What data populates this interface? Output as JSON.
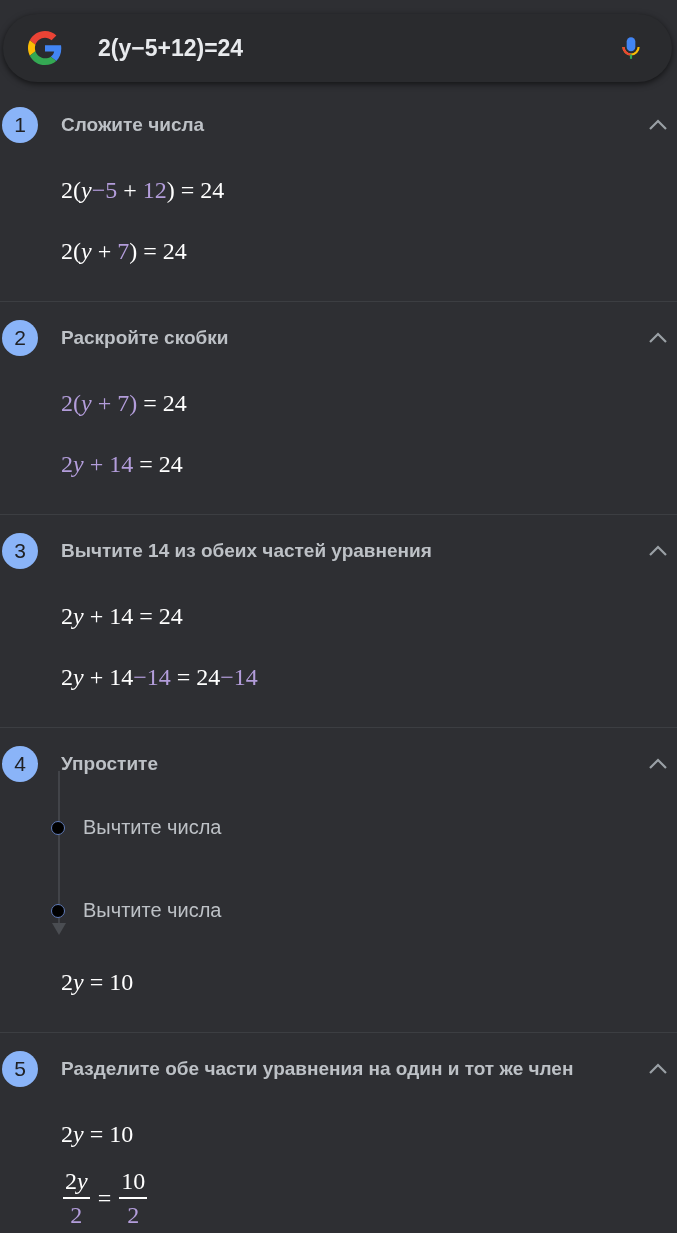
{
  "search": {
    "query": "2(y−5+12)=24"
  },
  "steps": [
    {
      "number": "1",
      "title": "Сложите числа",
      "expanded": true,
      "lines": [
        {
          "kind": "equation",
          "segments": [
            {
              "kind": "text",
              "text": "2(",
              "highlight": false
            },
            {
              "kind": "variable",
              "text": "y",
              "highlight": false
            },
            {
              "kind": "text",
              "text": "−5",
              "highlight": true
            },
            {
              "kind": "text",
              "text": " + ",
              "highlight": false
            },
            {
              "kind": "text",
              "text": "12",
              "highlight": true
            },
            {
              "kind": "text",
              "text": ") = 24",
              "highlight": false
            }
          ]
        },
        {
          "kind": "equation",
          "segments": [
            {
              "kind": "text",
              "text": "2(",
              "highlight": false
            },
            {
              "kind": "variable",
              "text": "y",
              "highlight": false
            },
            {
              "kind": "text",
              "text": " + ",
              "highlight": false
            },
            {
              "kind": "text",
              "text": "7",
              "highlight": true
            },
            {
              "kind": "text",
              "text": ") = 24",
              "highlight": false
            }
          ]
        }
      ]
    },
    {
      "number": "2",
      "title": "Раскройте скобки",
      "expanded": true,
      "lines": [
        {
          "kind": "equation",
          "segments": [
            {
              "kind": "text",
              "text": "2(",
              "highlight": true
            },
            {
              "kind": "variable",
              "text": "y",
              "highlight": true
            },
            {
              "kind": "text",
              "text": " + 7)",
              "highlight": true
            },
            {
              "kind": "text",
              "text": " = 24",
              "highlight": false
            }
          ]
        },
        {
          "kind": "equation",
          "segments": [
            {
              "kind": "text",
              "text": "2",
              "highlight": true
            },
            {
              "kind": "variable",
              "text": "y",
              "highlight": true
            },
            {
              "kind": "text",
              "text": " + 14",
              "highlight": true
            },
            {
              "kind": "text",
              "text": " = 24",
              "highlight": false
            }
          ]
        }
      ]
    },
    {
      "number": "3",
      "title": "Вычтите 14 из обеих частей уравнения",
      "expanded": true,
      "lines": [
        {
          "kind": "equation",
          "segments": [
            {
              "kind": "text",
              "text": "2",
              "highlight": false
            },
            {
              "kind": "variable",
              "text": "y",
              "highlight": false
            },
            {
              "kind": "text",
              "text": " + 14 = 24",
              "highlight": false
            }
          ]
        },
        {
          "kind": "equation",
          "segments": [
            {
              "kind": "text",
              "text": "2",
              "highlight": false
            },
            {
              "kind": "variable",
              "text": "y",
              "highlight": false
            },
            {
              "kind": "text",
              "text": " + 14",
              "highlight": false
            },
            {
              "kind": "text",
              "text": "−14",
              "highlight": true
            },
            {
              "kind": "text",
              "text": " = 24",
              "highlight": false
            },
            {
              "kind": "text",
              "text": "−14",
              "highlight": true
            }
          ]
        }
      ]
    },
    {
      "number": "4",
      "title": "Упростите",
      "expanded": true,
      "substeps": [
        {
          "label": "Вычтите числа"
        },
        {
          "label": "Вычтите числа"
        }
      ],
      "lines": [
        {
          "kind": "equation",
          "segments": [
            {
              "kind": "text",
              "text": "2",
              "highlight": false
            },
            {
              "kind": "variable",
              "text": "y",
              "highlight": false
            },
            {
              "kind": "text",
              "text": " = 10",
              "highlight": false
            }
          ]
        }
      ]
    },
    {
      "number": "5",
      "title": "Разделите обе части уравнения на один и тот же член",
      "expanded": true,
      "lines": [
        {
          "kind": "equation",
          "segments": [
            {
              "kind": "text",
              "text": "2",
              "highlight": false
            },
            {
              "kind": "variable",
              "text": "y",
              "highlight": false
            },
            {
              "kind": "text",
              "text": " = 10",
              "highlight": false
            }
          ]
        },
        {
          "kind": "fraction",
          "relation": "=",
          "left": {
            "numerator": [
              {
                "kind": "text",
                "text": "2",
                "highlight": false
              },
              {
                "kind": "variable",
                "text": "y",
                "highlight": false
              }
            ],
            "denominator": [
              {
                "kind": "text",
                "text": "2",
                "highlight": true
              }
            ]
          },
          "right": {
            "numerator": [
              {
                "kind": "text",
                "text": "10",
                "highlight": false
              }
            ],
            "denominator": [
              {
                "kind": "text",
                "text": "2",
                "highlight": true
              }
            ]
          }
        }
      ]
    }
  ]
}
